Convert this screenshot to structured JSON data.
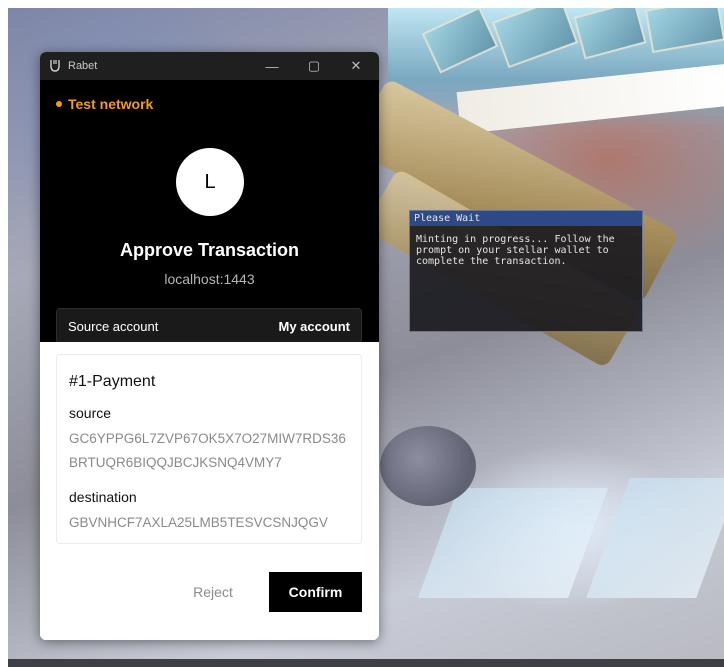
{
  "window": {
    "app_name": "Rabet",
    "controls": {
      "minimize": "—",
      "maximize": "▢",
      "close": "✕"
    }
  },
  "network": {
    "label": "Test network",
    "color": "#f29b1d"
  },
  "site": {
    "avatar_letter": "L",
    "title": "Approve Transaction",
    "host": "localhost:1443"
  },
  "account": {
    "left_label": "Source account",
    "right_label": "My account"
  },
  "operation": {
    "title": "#1-Payment",
    "source_label": "source",
    "source_value": "GC6YPPG6L7ZVP67OK5X7O27MIW7RDS36BRTUQR6BIQQJBCJKSNQ4VMY7",
    "destination_label": "destination",
    "destination_value": "GBVNHCF7AXLA25LMB5TESVCSNJQGV"
  },
  "actions": {
    "reject": "Reject",
    "confirm": "Confirm"
  },
  "game_dialog": {
    "title": "Please Wait",
    "message": "Minting in progress... Follow the prompt on your stellar wallet to complete the transaction."
  }
}
